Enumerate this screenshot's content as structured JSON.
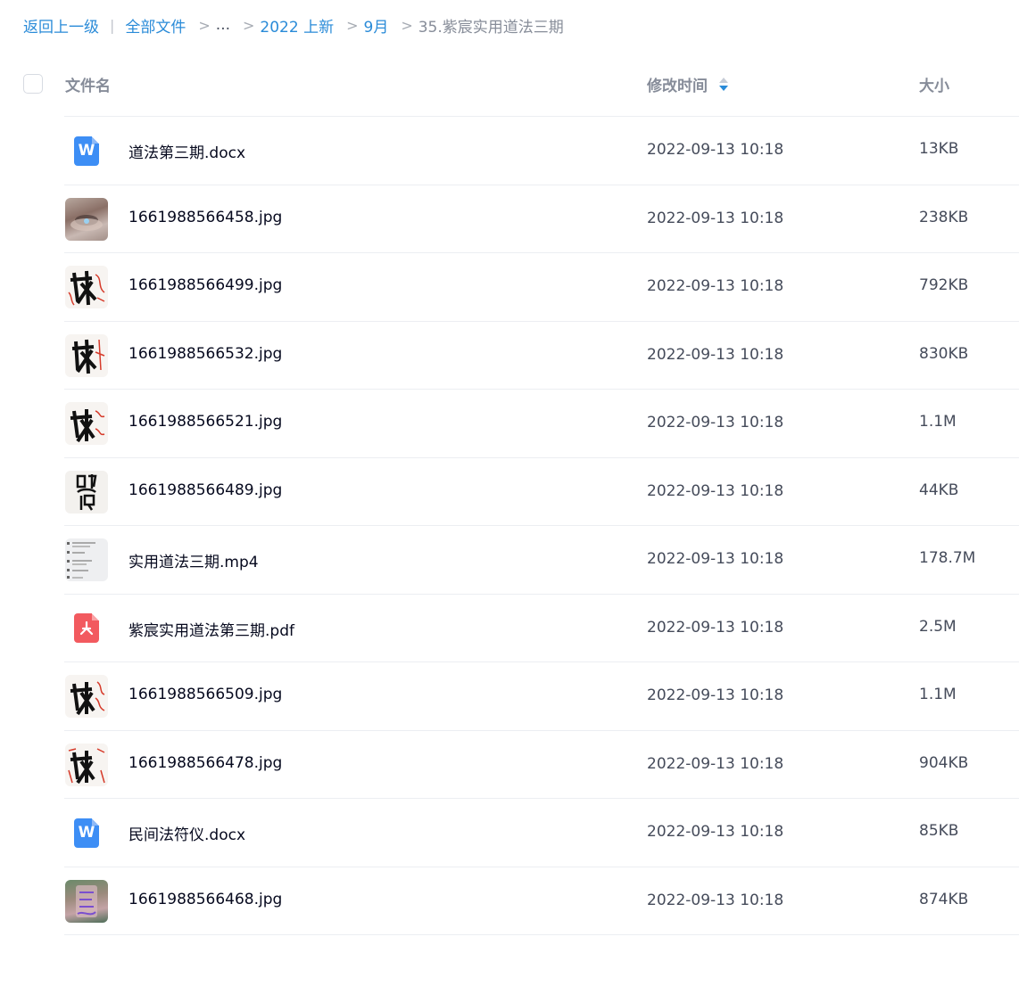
{
  "breadcrumb": {
    "back": "返回上一级",
    "separator": "|",
    "items": [
      {
        "label": "全部文件"
      },
      {
        "label": "..."
      },
      {
        "label": "2022 上新"
      },
      {
        "label": "9月"
      },
      {
        "label": "35.紫宸实用道法三期"
      }
    ],
    "arrow": ">"
  },
  "table": {
    "columns": {
      "name": "文件名",
      "modified": "修改时间",
      "size": "大小"
    },
    "sort": {
      "column": "修改时间",
      "direction": "descending"
    },
    "rows": [
      {
        "icon": "word-doc-icon",
        "name": "道法第三期.docx",
        "modified": "2022-09-13 10:18",
        "size": "13KB"
      },
      {
        "icon": "image-thumbnail",
        "name": "1661988566458.jpg",
        "modified": "2022-09-13 10:18",
        "size": "238KB"
      },
      {
        "icon": "image-thumbnail",
        "name": "1661988566499.jpg",
        "modified": "2022-09-13 10:18",
        "size": "792KB"
      },
      {
        "icon": "image-thumbnail",
        "name": "1661988566532.jpg",
        "modified": "2022-09-13 10:18",
        "size": "830KB"
      },
      {
        "icon": "image-thumbnail",
        "name": "1661988566521.jpg",
        "modified": "2022-09-13 10:18",
        "size": "1.1M"
      },
      {
        "icon": "image-thumbnail",
        "name": "1661988566489.jpg",
        "modified": "2022-09-13 10:18",
        "size": "44KB"
      },
      {
        "icon": "video-thumbnail",
        "name": "实用道法三期.mp4",
        "modified": "2022-09-13 10:18",
        "size": "178.7M"
      },
      {
        "icon": "pdf-icon",
        "name": "紫宸实用道法第三期.pdf",
        "modified": "2022-09-13 10:18",
        "size": "2.5M"
      },
      {
        "icon": "image-thumbnail",
        "name": "1661988566509.jpg",
        "modified": "2022-09-13 10:18",
        "size": "1.1M"
      },
      {
        "icon": "image-thumbnail",
        "name": "1661988566478.jpg",
        "modified": "2022-09-13 10:18",
        "size": "904KB"
      },
      {
        "icon": "word-doc-icon",
        "name": "民间法符仪.docx",
        "modified": "2022-09-13 10:18",
        "size": "85KB"
      },
      {
        "icon": "image-thumbnail",
        "name": "1661988566468.jpg",
        "modified": "2022-09-13 10:18",
        "size": "874KB"
      }
    ]
  },
  "icons": {
    "word_letter": "W"
  },
  "colors": {
    "link": "#2a8bd8",
    "word": "#3d8ef5",
    "pdf": "#f25a5f"
  }
}
